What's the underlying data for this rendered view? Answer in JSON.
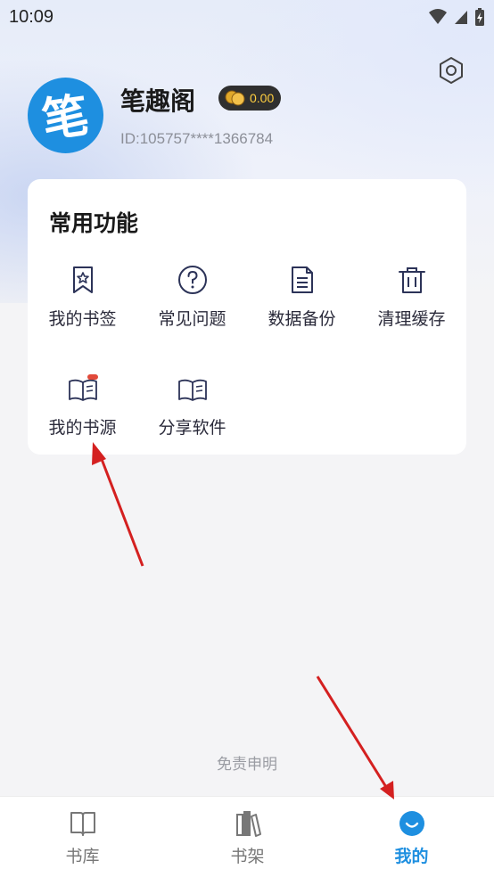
{
  "status_bar": {
    "time": "10:09"
  },
  "header": {
    "app_name": "笔趣阁",
    "avatar_char": "笔",
    "coin_balance": "0.00",
    "user_id": "ID:105757****1366784"
  },
  "functions": {
    "title": "常用功能",
    "items": [
      {
        "label": "我的书签",
        "icon": "bookmark-star-icon"
      },
      {
        "label": "常见问题",
        "icon": "question-circle-icon"
      },
      {
        "label": "数据备份",
        "icon": "document-icon"
      },
      {
        "label": "清理缓存",
        "icon": "trash-icon"
      },
      {
        "label": "我的书源",
        "icon": "book-new-icon"
      },
      {
        "label": "分享软件",
        "icon": "open-book-icon"
      }
    ]
  },
  "disclaimer": "免责申明",
  "bottom_nav": {
    "items": [
      {
        "label": "书库",
        "icon": "book-icon",
        "active": false
      },
      {
        "label": "书架",
        "icon": "bookshelf-icon",
        "active": false
      },
      {
        "label": "我的",
        "icon": "smile-circle-icon",
        "active": true
      }
    ]
  },
  "colors": {
    "accent": "#1e8fe0",
    "annotation_arrow": "#d42020",
    "coin": "#ffcf40"
  }
}
